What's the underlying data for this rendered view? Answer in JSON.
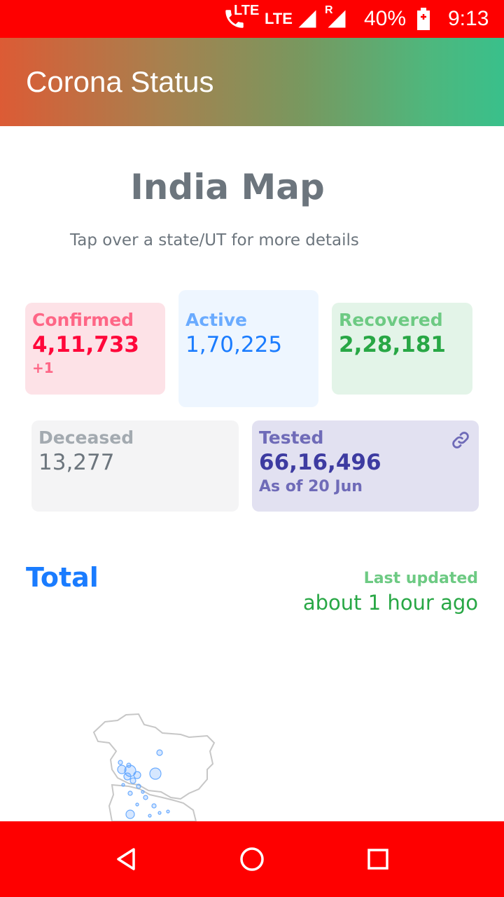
{
  "status_bar": {
    "lte1": "LTE",
    "lte2": "LTE",
    "roaming": "R",
    "battery": "40%",
    "time": "9:13",
    "icons": [
      "call-icon",
      "signal-icon",
      "roaming-signal-icon",
      "battery-charging-icon"
    ]
  },
  "app_bar": {
    "title": "Corona Status"
  },
  "map_header": {
    "title": "India Map",
    "subtitle": "Tap over a state/UT for more details"
  },
  "stats": {
    "confirmed": {
      "label": "Confirmed",
      "value": "4,11,733",
      "delta": "+1"
    },
    "active": {
      "label": "Active",
      "value": "1,70,225"
    },
    "recovered": {
      "label": "Recovered",
      "value": "2,28,181"
    },
    "deceased": {
      "label": "Deceased",
      "value": "13,277"
    },
    "tested": {
      "label": "Tested",
      "value": "66,16,496",
      "note": "As of 20 Jun",
      "icon": "link-icon"
    }
  },
  "total_row": {
    "label": "Total",
    "last_updated_label": "Last updated",
    "last_updated_value": "about 1 hour ago"
  },
  "nav_bar": {
    "buttons": [
      "back-icon",
      "home-icon",
      "recents-icon"
    ]
  },
  "colors": {
    "status_bar": "#fe0000",
    "confirmed": "#ff073a",
    "active": "#1a7cff",
    "recovered": "#28a745",
    "deceased": "#6c757d",
    "tested": "#3d3ba1"
  }
}
